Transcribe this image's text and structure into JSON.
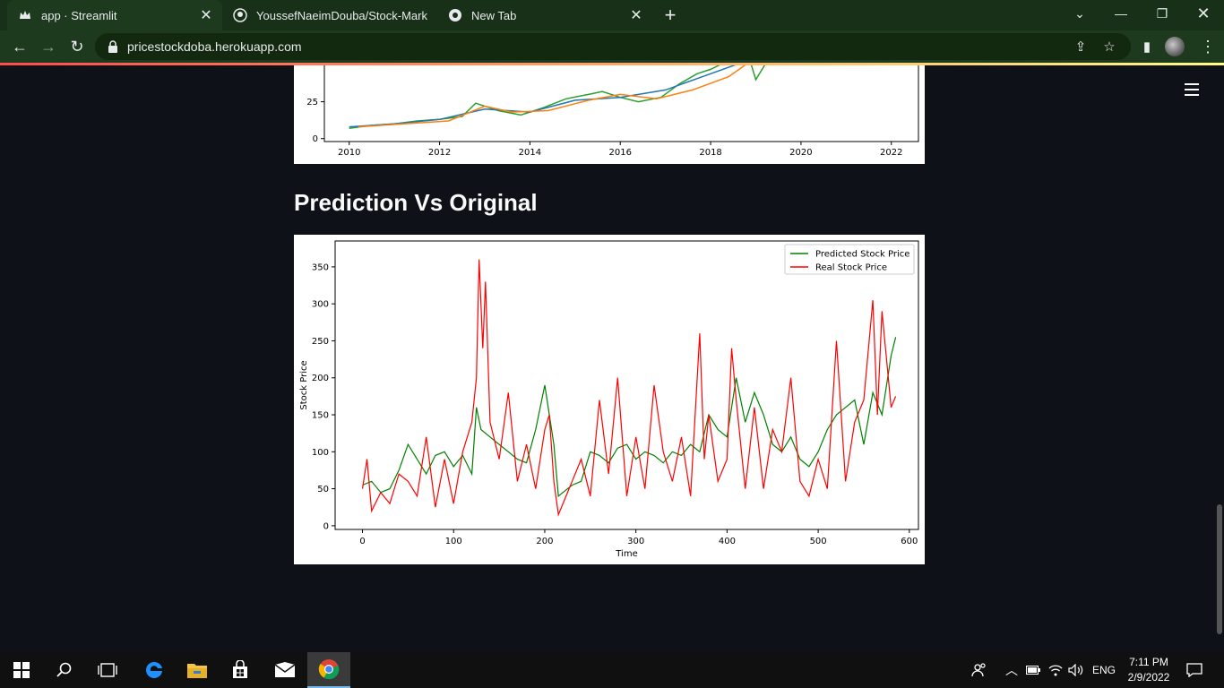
{
  "browser": {
    "tabs": [
      {
        "title": "app · Streamlit",
        "active": true,
        "icon": "streamlit-crown-icon"
      },
      {
        "title": "YoussefNaeimDouba/Stock-Mark",
        "active": false,
        "icon": "github-icon"
      },
      {
        "title": "New Tab",
        "active": false,
        "icon": "chrome-icon"
      }
    ],
    "url": "pricestockdoba.herokuapp.com",
    "colors": {
      "frame": "#1e3a1e",
      "page_bg": "#0e1117"
    }
  },
  "page": {
    "heading": "Prediction Vs Original"
  },
  "chart_data": [
    {
      "type": "line",
      "partially_visible": true,
      "x_ticks": [
        "2010",
        "2012",
        "2014",
        "2016",
        "2018",
        "2020",
        "2022"
      ],
      "y_ticks": [
        "0",
        "25"
      ],
      "series": [
        {
          "color": "#2ca02c",
          "x": [
            2010.0,
            2010.5,
            2011.0,
            2011.5,
            2012.0,
            2012.5,
            2012.8,
            2013.3,
            2013.8,
            2014.3,
            2014.8,
            2015.3,
            2015.6,
            2016.0,
            2016.4,
            2016.9,
            2017.3,
            2017.7,
            2018.0,
            2018.4,
            2018.8,
            2019.0,
            2019.3,
            2019.6
          ],
          "y": [
            7,
            9,
            10,
            12,
            13,
            15,
            24,
            19,
            16,
            21,
            27,
            30,
            32,
            28,
            25,
            28,
            37,
            44,
            47,
            53,
            60,
            40,
            55,
            58
          ]
        },
        {
          "color": "#1f77b4",
          "x": [
            2010.0,
            2011.0,
            2012.0,
            2013.0,
            2014.0,
            2015.0,
            2016.0,
            2017.0,
            2018.0,
            2019.0,
            2019.6
          ],
          "y": [
            8,
            10,
            13,
            20,
            18,
            26,
            28,
            33,
            44,
            55,
            60
          ]
        },
        {
          "color": "#ff7f0e",
          "x": [
            2010.2,
            2011.2,
            2012.2,
            2013.0,
            2013.6,
            2014.4,
            2015.3,
            2016.0,
            2016.8,
            2017.6,
            2018.4,
            2019.0,
            2019.6
          ],
          "y": [
            8,
            10,
            12,
            22,
            18,
            19,
            26,
            30,
            27,
            33,
            42,
            55,
            57
          ]
        }
      ]
    },
    {
      "type": "line",
      "title": "",
      "xlabel": "Time",
      "ylabel": "Stock Price",
      "xlim": [
        -30,
        610
      ],
      "ylim": [
        -5,
        385
      ],
      "x_ticks": [
        0,
        100,
        200,
        300,
        400,
        500,
        600
      ],
      "y_ticks": [
        0,
        50,
        100,
        150,
        200,
        250,
        300,
        350
      ],
      "legend_position": "top-right",
      "series": [
        {
          "name": "Predicted  Stock Price",
          "color": "#008000",
          "x": [
            0,
            10,
            20,
            30,
            40,
            50,
            60,
            70,
            80,
            90,
            100,
            110,
            120,
            125,
            130,
            140,
            150,
            160,
            170,
            180,
            190,
            200,
            210,
            215,
            220,
            230,
            240,
            250,
            260,
            270,
            280,
            290,
            300,
            310,
            320,
            330,
            340,
            350,
            360,
            370,
            380,
            390,
            400,
            410,
            420,
            430,
            440,
            450,
            460,
            470,
            480,
            490,
            500,
            510,
            520,
            530,
            540,
            550,
            560,
            570,
            580,
            585
          ],
          "y": [
            55,
            60,
            45,
            50,
            75,
            110,
            90,
            70,
            95,
            100,
            80,
            95,
            70,
            160,
            130,
            120,
            110,
            100,
            90,
            85,
            130,
            190,
            110,
            40,
            45,
            55,
            60,
            100,
            95,
            85,
            105,
            110,
            90,
            100,
            95,
            85,
            100,
            95,
            110,
            100,
            150,
            130,
            120,
            200,
            140,
            180,
            150,
            110,
            100,
            120,
            90,
            80,
            100,
            130,
            150,
            160,
            170,
            110,
            180,
            150,
            230,
            255
          ]
        },
        {
          "name": "Real Stock Price",
          "color": "#ff0000",
          "x": [
            0,
            5,
            10,
            20,
            30,
            40,
            50,
            60,
            70,
            80,
            90,
            100,
            110,
            120,
            125,
            128,
            132,
            135,
            140,
            150,
            160,
            170,
            180,
            190,
            200,
            205,
            210,
            215,
            220,
            230,
            240,
            250,
            260,
            270,
            280,
            290,
            300,
            310,
            320,
            330,
            340,
            350,
            360,
            370,
            375,
            380,
            390,
            400,
            405,
            410,
            420,
            430,
            440,
            450,
            460,
            470,
            480,
            490,
            500,
            510,
            520,
            530,
            540,
            550,
            560,
            565,
            570,
            580,
            585
          ],
          "y": [
            50,
            90,
            20,
            45,
            30,
            70,
            60,
            40,
            120,
            25,
            90,
            30,
            100,
            140,
            200,
            360,
            240,
            330,
            140,
            90,
            180,
            60,
            110,
            50,
            130,
            150,
            60,
            15,
            30,
            60,
            90,
            40,
            170,
            70,
            200,
            40,
            120,
            50,
            190,
            100,
            60,
            120,
            40,
            260,
            90,
            150,
            60,
            90,
            240,
            170,
            50,
            160,
            50,
            130,
            100,
            200,
            60,
            40,
            90,
            50,
            250,
            60,
            140,
            170,
            305,
            150,
            290,
            160,
            175
          ]
        }
      ]
    }
  ],
  "taskbar": {
    "items": [
      "windows-start-icon",
      "search-icon",
      "task-view-icon",
      "edge-icon",
      "file-explorer-icon",
      "store-icon",
      "mail-icon",
      "chrome-icon"
    ],
    "language": "ENG",
    "time": "7:11 PM",
    "date": "2/9/2022"
  }
}
